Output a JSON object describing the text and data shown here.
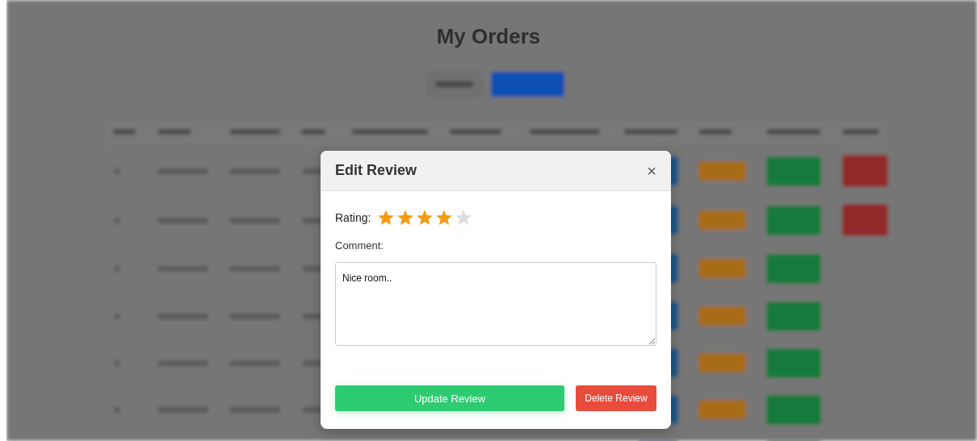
{
  "page": {
    "title": "My Orders"
  },
  "modal": {
    "title": "Edit Review",
    "close": "×",
    "rating": {
      "label": "Rating:",
      "stars": 4
    },
    "comment": {
      "label": "Comment:",
      "value": "Nice room.."
    },
    "buttons": [
      {
        "kind": "update",
        "label": "Update Review"
      },
      {
        "kind": "delete",
        "label": "Delete Review"
      }
    ]
  }
}
